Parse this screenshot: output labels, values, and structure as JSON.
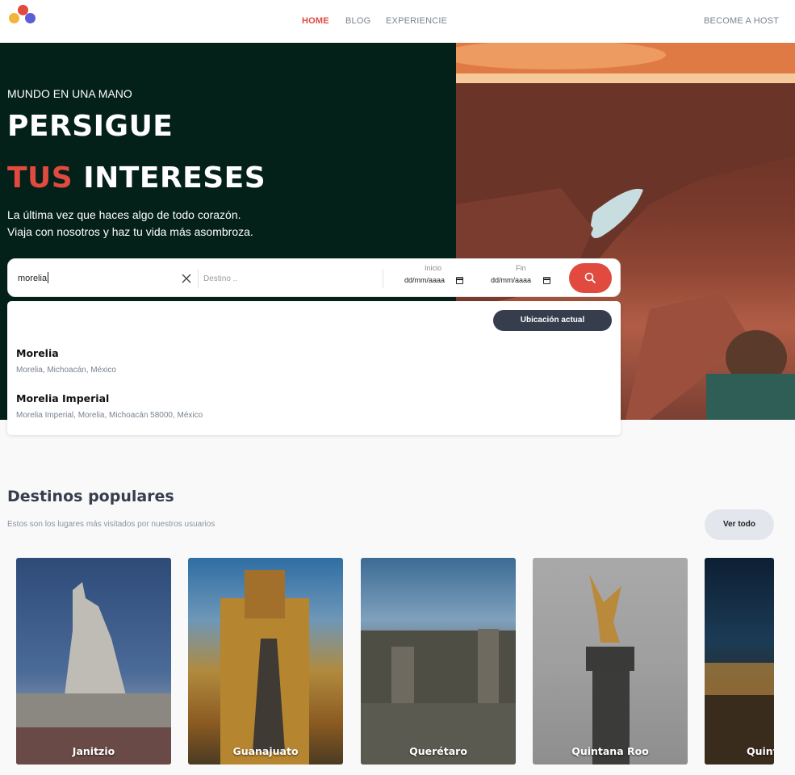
{
  "nav": {
    "links": [
      {
        "label": "HOME",
        "active": true
      },
      {
        "label": "BLOG",
        "active": false
      },
      {
        "label": "EXPERIENCIE",
        "active": false
      }
    ],
    "host_label": "BECOME A HOST"
  },
  "hero": {
    "kicker": "MUNDO EN UNA MANO",
    "title_line1": "PERSIGUE",
    "title_accent": "TUS",
    "title_rest": "INTERESES",
    "desc_line1": "La última vez que haces algo de todo corazón.",
    "desc_line2": "Viaja con nosotros y haz tu vida más asombroza."
  },
  "search": {
    "origin_value": "morelia",
    "destination_placeholder": "Destino ..",
    "start_label": "Inicio",
    "end_label": "Fin",
    "start_value": "dd/mm/aaaa",
    "end_value": "dd/mm/aaaa"
  },
  "dropdown": {
    "current_location_label": "Ubicación actual",
    "suggestions": [
      {
        "name": "Morelia",
        "address": "Morelia, Michoacán, México"
      },
      {
        "name": "Morelia Imperial",
        "address": "Morelia Imperial, Morelia, Michoacán 58000, México"
      }
    ]
  },
  "popular": {
    "title": "Destinos populares",
    "subtitle": "Estos son los lugares más visitados por nuestros usuarios",
    "view_all_label": "Ver todo",
    "cards": [
      {
        "name": "Janitzio"
      },
      {
        "name": "Guanajuato"
      },
      {
        "name": "Querétaro"
      },
      {
        "name": "Quintana Roo"
      },
      {
        "name": "Quint"
      }
    ]
  },
  "colors": {
    "accent": "#e04a3f",
    "hero_bg": "#032019",
    "dark_button": "#363e4d"
  }
}
